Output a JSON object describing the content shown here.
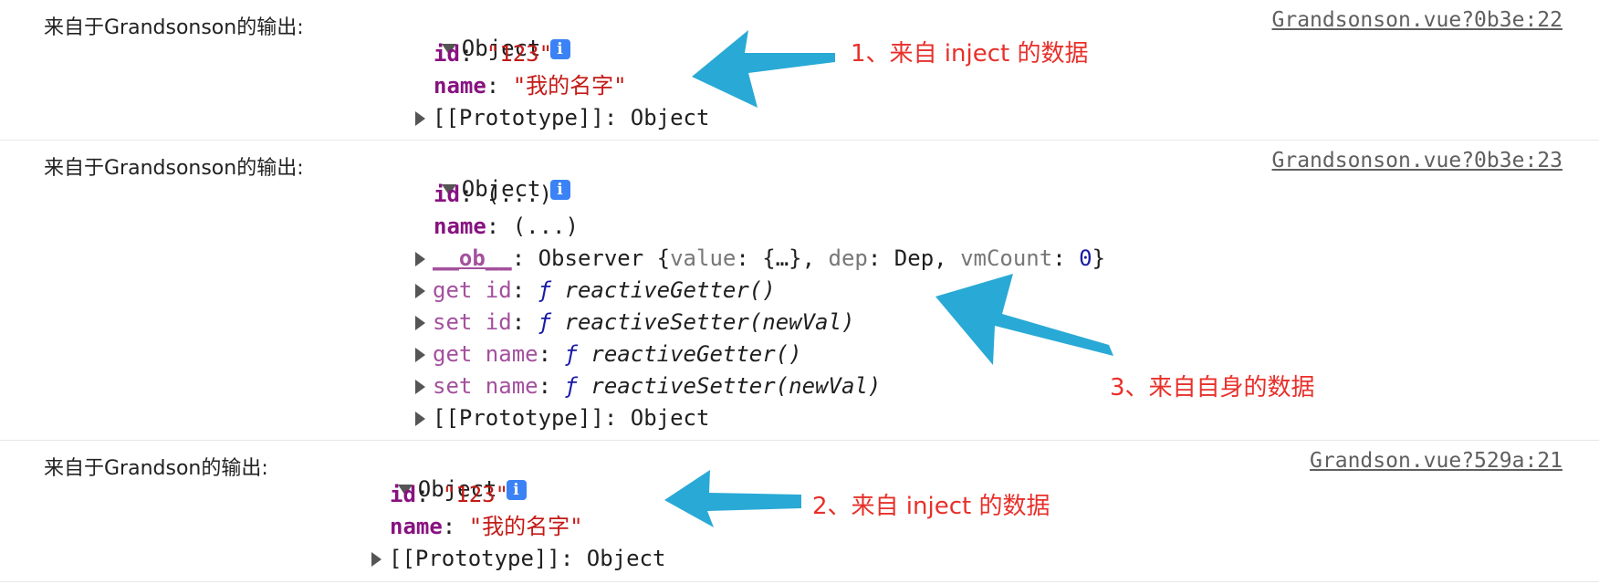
{
  "entries": [
    {
      "prefix": "来自于Grandsonson的输出:",
      "object_label": "Object",
      "info_icon": "i",
      "source": "Grandsonson.vue?0b3e:22",
      "id_key": "id",
      "id_value": "\"123\"",
      "name_key": "name",
      "name_value": "\"我的名字\"",
      "proto_key": "[[Prototype]]",
      "proto_value": "Object"
    },
    {
      "prefix": "来自于Grandsonson的输出:",
      "object_label": "Object",
      "info_icon": "i",
      "source": "Grandsonson.vue?0b3e:23",
      "id_key": "id",
      "id_value": "(...)",
      "name_key": "name",
      "name_value": "(...)",
      "ob_key": "__ob__",
      "ob_prefix": "Observer {",
      "ob_value_key": "value",
      "ob_value_val": "{…}",
      "ob_dep_key": "dep",
      "ob_dep_val": "Dep",
      "ob_vm_key": "vmCount",
      "ob_vm_val": "0",
      "ob_suffix": "}",
      "get_id_key": "get id",
      "set_id_key": "set id",
      "get_name_key": "get name",
      "set_name_key": "set name",
      "f_symbol": "ƒ",
      "getter": "reactiveGetter()",
      "setter": "reactiveSetter(newVal)",
      "proto_key": "[[Prototype]]",
      "proto_value": "Object"
    },
    {
      "prefix": "来自于Grandson的输出:",
      "object_label": "Object",
      "info_icon": "i",
      "source": "Grandson.vue?529a:21",
      "id_key": "id",
      "id_value": "\"123\"",
      "name_key": "name",
      "name_value": "\"我的名字\"",
      "proto_key": "[[Prototype]]",
      "proto_value": "Object"
    }
  ],
  "annotations": {
    "a1": "1、来自 inject 的数据",
    "a2": "2、来自 inject 的数据",
    "a3": "3、来自自身的数据"
  },
  "colors": {
    "arrow": "#29a9d6",
    "annotation": "#e8302a",
    "key": "#881280",
    "string": "#c41a16"
  }
}
